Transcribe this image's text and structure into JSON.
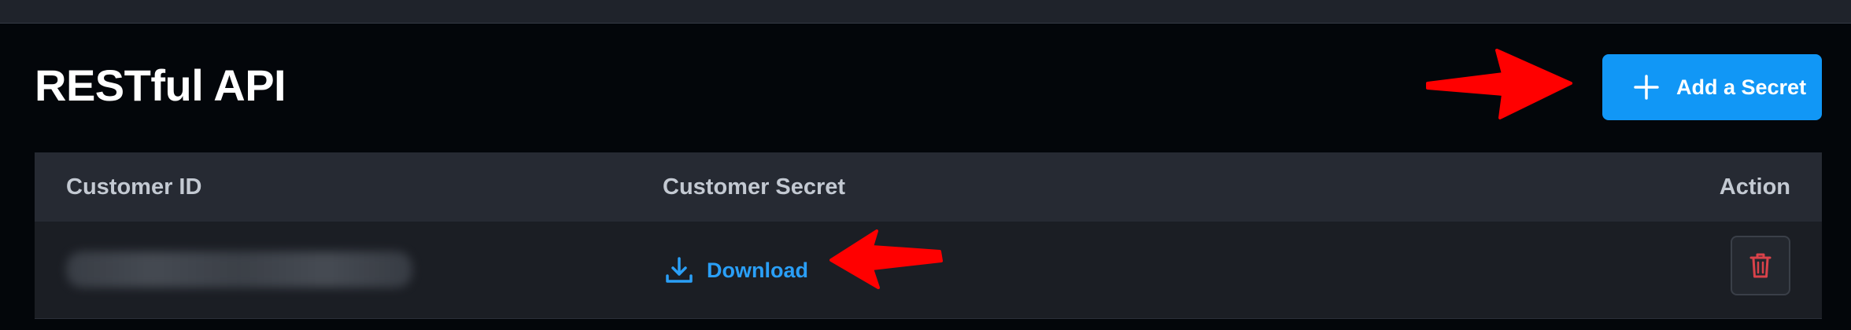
{
  "header": {
    "title": "RESTful API",
    "add_button_label": "Add a Secret",
    "add_icon": "plus-icon"
  },
  "table": {
    "columns": [
      "Customer ID",
      "Customer Secret",
      "Action"
    ],
    "rows": [
      {
        "customer_id": "",
        "customer_id_state": "blurred",
        "secret_link_label": "Download",
        "secret_icon": "download-icon",
        "action_icon": "trash-icon"
      }
    ]
  },
  "annotations": [
    {
      "type": "arrow",
      "color": "#ff0000",
      "points_to": "add-secret-button"
    },
    {
      "type": "arrow",
      "color": "#ff0000",
      "points_to": "download-link"
    }
  ],
  "colors": {
    "background": "#03060a",
    "accent": "#1197f6",
    "link": "#2a9ff7",
    "danger": "#d9424a",
    "annotation": "#ff0000"
  }
}
